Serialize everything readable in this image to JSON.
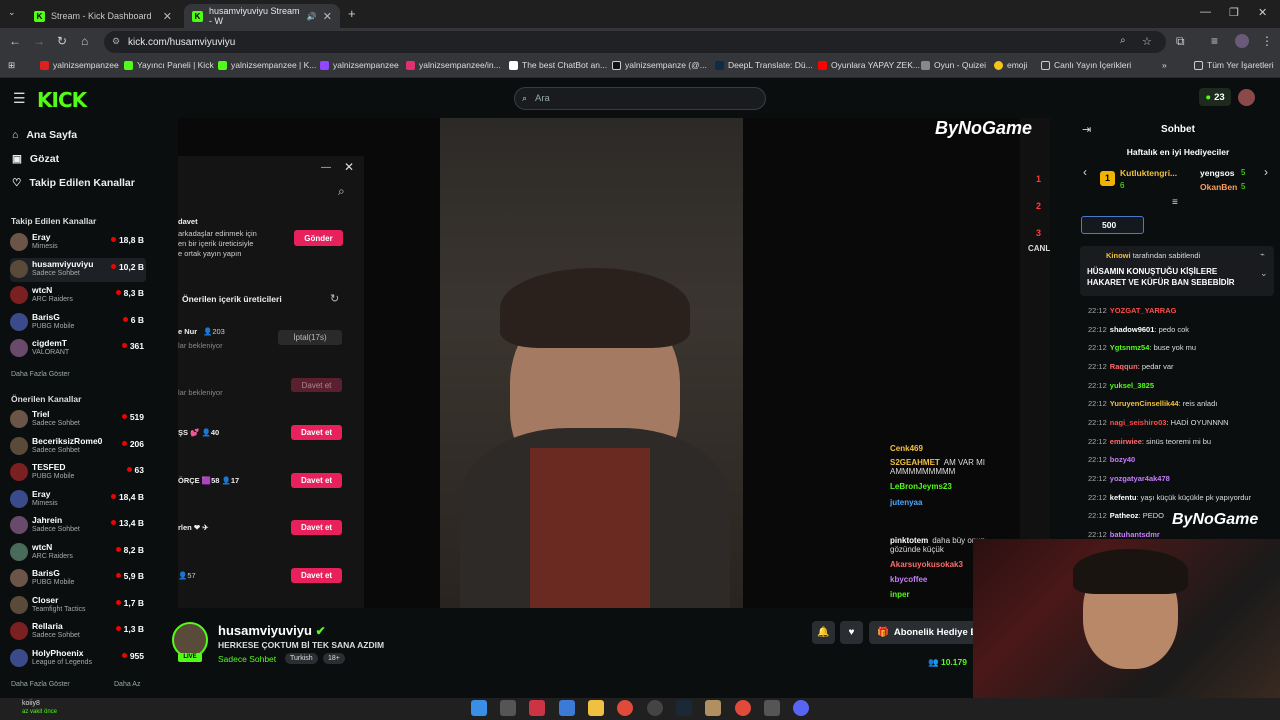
{
  "browser": {
    "tabs": [
      {
        "title": "Stream - Kick Dashboard"
      },
      {
        "title": "husamviyuviyu Stream - W"
      }
    ],
    "url": "kick.com/husamviyuviyu",
    "bookmarks": [
      "yalnizsempanzee",
      "Yayıncı Paneli | Kick",
      "yalnizsempanzee | K...",
      "yalnizsempanzee",
      "yalnizsempanzee/in...",
      "The best ChatBot an...",
      "yalnizsempanze (@...",
      "DeepL Translate: Dü...",
      "Oyunlara YAPAY ZEK...",
      "Oyun - Quizei",
      "emoji",
      "Canlı Yayın İçerikleri"
    ],
    "all_bookmarks": "Tüm Yer İşaretleri"
  },
  "header": {
    "logo": "KICK",
    "search_placeholder": "Ara",
    "points": "23"
  },
  "sidebar": {
    "nav": [
      {
        "label": "Ana Sayfa"
      },
      {
        "label": "Gözat"
      },
      {
        "label": "Takip Edilen Kanallar"
      }
    ],
    "followed_title": "Takip Edilen Kanallar",
    "followed": [
      {
        "name": "Eray",
        "category": "Mimesis",
        "viewers": "18,8 B"
      },
      {
        "name": "husamviyuviyu",
        "category": "Sadece Sohbet",
        "viewers": "10,2 B"
      },
      {
        "name": "wtcN",
        "category": "ARC Raiders",
        "viewers": "8,3 B"
      },
      {
        "name": "BarisG",
        "category": "PUBG Mobile",
        "viewers": "6 B"
      },
      {
        "name": "cigdemT",
        "category": "VALORANT",
        "viewers": "361"
      }
    ],
    "show_more": "Daha Fazla Göster",
    "suggested_title": "Önerilen Kanallar",
    "suggested": [
      {
        "name": "Triel",
        "category": "Sadece Sohbet",
        "viewers": "519"
      },
      {
        "name": "BeceriksizRome0",
        "category": "Sadece Sohbet",
        "viewers": "206"
      },
      {
        "name": "TESFED",
        "category": "PUBG Mobile",
        "viewers": "63"
      },
      {
        "name": "Eray",
        "category": "Mimesis",
        "viewers": "18,4 B"
      },
      {
        "name": "Jahrein",
        "category": "Sadece Sohbet",
        "viewers": "13,4 B"
      },
      {
        "name": "wtcN",
        "category": "ARC Raiders",
        "viewers": "8,2 B"
      },
      {
        "name": "BarisG",
        "category": "PUBG Mobile",
        "viewers": "5,9 B"
      },
      {
        "name": "Closer",
        "category": "Teamfight Tactics",
        "viewers": "1,7 B"
      },
      {
        "name": "Rellaria",
        "category": "Sadece Sohbet",
        "viewers": "1,3 B"
      },
      {
        "name": "HolyPhoenix",
        "category": "League of Legends",
        "viewers": "955"
      }
    ],
    "show_more2": "Daha Fazla Göster",
    "show_less": "Daha Az"
  },
  "video_popup": {
    "invite_title": "davet",
    "invite_text1": "arkadaşlar edinmek için",
    "invite_text2": "en bir içerik üreticisiyle",
    "invite_text3": "e ortak yayın yapın",
    "send": "Gönder",
    "suggested_creators": "Önerilen içerik üreticileri",
    "row1_name": "e Nur",
    "row1_count": "203",
    "row1_sub": "lar bekleniyor",
    "cancel": "İptal(17s)",
    "row2_sub": "lar bekleniyor",
    "invite": "Davet et",
    "row3_name": "ŞS",
    "row3_count": "40",
    "row4_name": "ÖRÇE",
    "row4_count": "17",
    "row4_extra": "58",
    "row5_name": "rlen",
    "row6_count": "57"
  },
  "video_overlay": {
    "brand": "ByNoGame",
    "rank": [
      "1",
      "2",
      "3"
    ],
    "side_label": "CANL",
    "chat": [
      {
        "user": "Cenk469",
        "text": "",
        "color": "#f0c040"
      },
      {
        "user": "S2GEAHMET",
        "text": "AM VAR MI AMMMMMMMMM",
        "color": "#f0c040"
      },
      {
        "user": "LeBronJeyms23",
        "text": "",
        "color": "#53fc18"
      },
      {
        "user": "jutenyaa",
        "text": "",
        "color": "#4aa8ff"
      },
      {
        "user": "pinktotem",
        "text": "daha büy onun gözünde küçük",
        "color": "#ffffff"
      },
      {
        "user": "Akarsuyokusokak3",
        "text": "",
        "color": "#ff6b6b"
      },
      {
        "user": "kbycoffee",
        "text": "",
        "color": "#c77dff"
      },
      {
        "user": "inper",
        "text": "",
        "color": "#53fc18"
      }
    ]
  },
  "streamer": {
    "name": "husamviyuviyu",
    "live": "LIVE",
    "title": "HERKESE ÇOKTUM Bİ TEK SANA AZDIM",
    "category": "Sadece Sohbet",
    "tags": [
      "Turkish",
      "18+"
    ],
    "subscribe": "Abonelik Hediye E",
    "viewers": "10.179"
  },
  "chat": {
    "title": "Sohbet",
    "top_gifters_title": "Haftalık en iyi Hediyeciler",
    "gifters": [
      {
        "name": "Kutluktengri...",
        "count": "6"
      },
      {
        "name": "yengsos",
        "count": "5"
      },
      {
        "name": "OkanBen",
        "count": "5"
      }
    ],
    "goal": "500",
    "pinned_by": "Kinowi",
    "pinned_by_text": "tarafından sabitlendi",
    "pinned_text": "HÜSAMIN KONUŞTUĞU KİŞİLERE HAKARET VE KÜFÜR BAN SEBEBİDİR",
    "messages": [
      {
        "time": "22:12",
        "user": "YOZGAT_YARRAG",
        "text": "",
        "color": "#ff4d4d"
      },
      {
        "time": "22:12",
        "user": "shadow9601",
        "text": "pedo cok",
        "color": "#ffffff"
      },
      {
        "time": "22:12",
        "user": "Ygtsnmz54",
        "text": "buse yok mu",
        "color": "#53fc18"
      },
      {
        "time": "22:12",
        "user": "Raqqun",
        "text": "pedar var",
        "color": "#ff6b6b"
      },
      {
        "time": "22:12",
        "user": "yuksel_3825",
        "text": "",
        "color": "#53fc18"
      },
      {
        "time": "22:12",
        "user": "YuruyenCinsellik44",
        "text": "reis anladı",
        "color": "#f0c040"
      },
      {
        "time": "22:12",
        "user": "nagi_seishiro03",
        "text": "HADİ OYUNNNN",
        "color": "#ff4d4d"
      },
      {
        "time": "22:12",
        "user": "emirwiee",
        "text": "sinüs teoremi mi bu",
        "color": "#ff6b6b"
      },
      {
        "time": "22:12",
        "user": "bozy40",
        "text": "",
        "color": "#c77dff"
      },
      {
        "time": "22:12",
        "user": "yozgatyar4ak478",
        "text": "",
        "color": "#c77dff"
      },
      {
        "time": "22:12",
        "user": "kefentu",
        "text": "yaşı küçük küçükle pk yapıyordur",
        "color": "#ffffff"
      },
      {
        "time": "22:12",
        "user": "Patheoz",
        "text": "PEDO",
        "color": "#ffffff"
      },
      {
        "time": "22:12",
        "user": "batuhantsdmr",
        "text": "",
        "color": "#c77dff"
      }
    ]
  },
  "taskbar": {
    "user": "koiiy8",
    "status": "az vakit önce"
  }
}
